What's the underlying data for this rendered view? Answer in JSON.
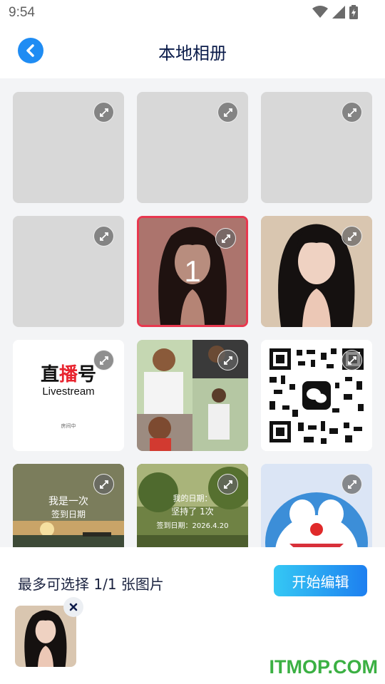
{
  "status_bar": {
    "time": "9:54"
  },
  "header": {
    "title": "本地相册"
  },
  "grid": {
    "selected_index_label": "1",
    "live_tile": {
      "title_part1": "直",
      "title_part2": "播",
      "title_part3": "号",
      "subtitle": "Livestream",
      "small_text": "房间中"
    },
    "quote_tile_1": {
      "line1": "我是一次",
      "line2": "签到日期"
    },
    "quote_tile_2": {
      "line1": "我的日期：",
      "line2": "坚持了 1次",
      "line3": "签到日期：2026.4.20"
    }
  },
  "bottom": {
    "hint": "最多可选择 1/1 张图片",
    "start_label": "开始编辑"
  },
  "watermark": "ITMOP.COM",
  "colors": {
    "accent": "#1f8cf3",
    "selected_border": "#e8384f",
    "watermark": "#3bb043"
  }
}
